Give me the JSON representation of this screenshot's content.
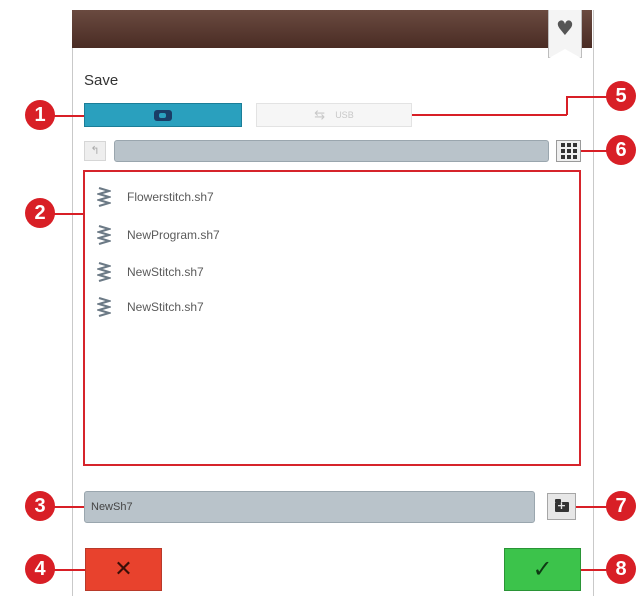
{
  "dialog": {
    "title": "Save",
    "favorite_icon": "heart-icon",
    "colors": {
      "titlebar": "#5a3a30",
      "location_active": "#2aa0be",
      "path_bar": "#b9c3ca",
      "list_highlight": "#d6242b",
      "cancel": "#e8422d",
      "confirm": "#3cc34b",
      "callout": "#d81f26"
    }
  },
  "locations": {
    "internal_icon": "machine-memory-icon",
    "usb_label": "USB",
    "usb_icon": "usb-icon"
  },
  "toolbar": {
    "folder_up_icon": "folder-up-icon",
    "grid_icon": "grid-view-icon",
    "new_folder_icon": "new-folder-icon"
  },
  "files": [
    {
      "name": "Flowerstitch.sh7",
      "icon": "stitch-file-icon"
    },
    {
      "name": "NewProgram.sh7",
      "icon": "stitch-file-icon"
    },
    {
      "name": "NewStitch.sh7",
      "icon": "stitch-file-icon"
    },
    {
      "name": "NewStitch.sh7",
      "icon": "stitch-file-icon"
    }
  ],
  "filename_field": {
    "value": "NewSh7"
  },
  "actions": {
    "cancel_symbol": "✕",
    "confirm_symbol": "✓"
  },
  "callouts": [
    "1",
    "2",
    "3",
    "4",
    "5",
    "6",
    "7",
    "8"
  ]
}
